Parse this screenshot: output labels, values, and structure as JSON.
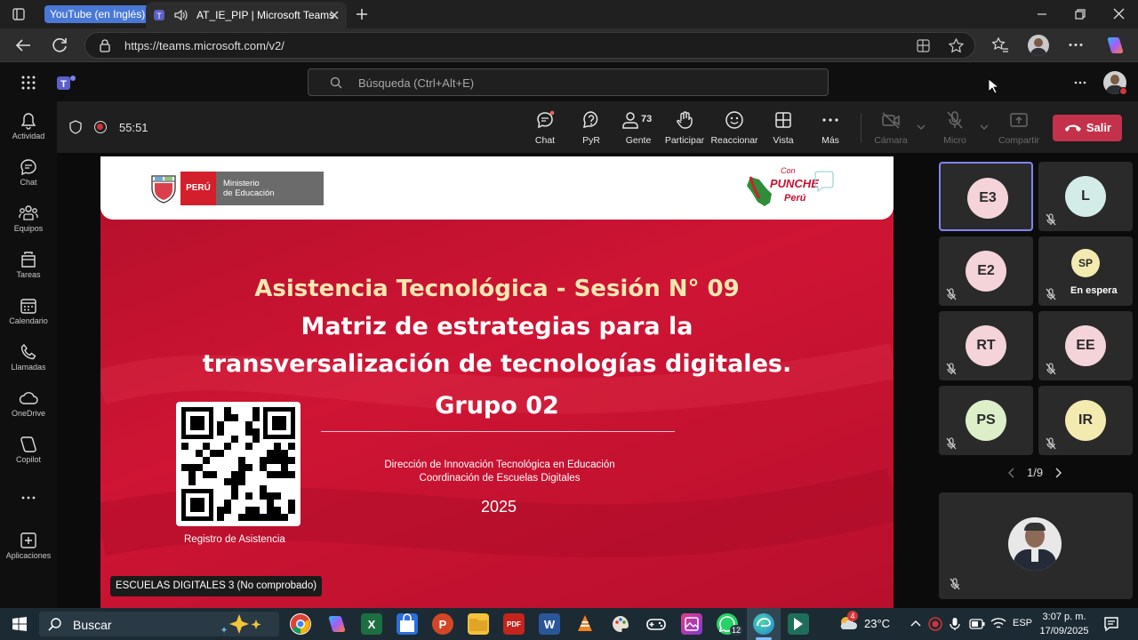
{
  "browser": {
    "tab_group": "YouTube (en Inglés)",
    "tab_title": "AT_IE_PIP | Microsoft Teams",
    "url": "https://teams.microsoft.com/v2/"
  },
  "teams": {
    "search_placeholder": "Búsqueda (Ctrl+Alt+E)",
    "rail": [
      {
        "label": "Actividad",
        "icon": "bell-icon"
      },
      {
        "label": "Chat",
        "icon": "chat-icon"
      },
      {
        "label": "Equipos",
        "icon": "teams-icon"
      },
      {
        "label": "Tareas",
        "icon": "tasks-icon"
      },
      {
        "label": "Calendario",
        "icon": "calendar-icon"
      },
      {
        "label": "Llamadas",
        "icon": "phone-icon"
      },
      {
        "label": "OneDrive",
        "icon": "cloud-icon"
      },
      {
        "label": "Copilot",
        "icon": "copilot-icon"
      },
      {
        "label": "Aplicaciones",
        "icon": "apps-plus-icon"
      }
    ]
  },
  "call": {
    "timer": "55:51",
    "toolbar": [
      {
        "label": "Chat",
        "icon": "chat-icon",
        "enabled": true
      },
      {
        "label": "PyR",
        "icon": "qna-icon",
        "enabled": true
      },
      {
        "label": "Gente",
        "icon": "people-icon",
        "badge": "73",
        "enabled": true
      },
      {
        "label": "Participar",
        "icon": "raise-hand-icon",
        "enabled": true
      },
      {
        "label": "Reaccionar",
        "icon": "smiley-icon",
        "enabled": true
      },
      {
        "label": "Vista",
        "icon": "grid-icon",
        "enabled": true
      },
      {
        "label": "Más",
        "icon": "more-icon",
        "enabled": true
      },
      {
        "label": "Cámara",
        "icon": "camera-off-icon",
        "enabled": false
      },
      {
        "label": "Micro",
        "icon": "mic-off-icon",
        "enabled": false
      },
      {
        "label": "Compartir",
        "icon": "share-icon",
        "enabled": false
      }
    ],
    "leave_label": "Salir",
    "presenter_name": "ESCUELAS DIGITALES 3 (No comprobado)"
  },
  "slide": {
    "peru": "PERÚ",
    "ministry_line1": "Ministerio",
    "ministry_line2": "de Educación",
    "brand_line1": "Con",
    "brand_line2": "PUNCHE",
    "brand_line3": "Perú",
    "title_line1": "Asistencia Tecnológica - Sesión N° 09",
    "title_line2": "Matriz de estrategias para la",
    "title_line3": "transversalización de tecnologías digitales.",
    "title_line4": "Grupo 02",
    "org_line1": "Dirección de Innovación Tecnológica en Educación",
    "org_line2": "Coordinación de Escuelas Digitales",
    "year": "2025",
    "qr_caption": "Registro de Asistencia"
  },
  "participants": [
    {
      "initials": "E3",
      "color": "#f4d3d9",
      "active": true
    },
    {
      "initials": "L",
      "color": "#d3ece7"
    },
    {
      "initials": "E2",
      "color": "#f4d3d9"
    },
    {
      "initials": "SP",
      "color": "#f3eab0",
      "status": "En espera"
    },
    {
      "initials": "RT",
      "color": "#f4d3d9"
    },
    {
      "initials": "EE",
      "color": "#f4d3d9"
    },
    {
      "initials": "PS",
      "color": "#dcefc9"
    },
    {
      "initials": "IR",
      "color": "#f3eab0"
    }
  ],
  "pagination": "1/9",
  "taskbar": {
    "search_label": "Buscar",
    "temperature": "23°C",
    "language": "ESP",
    "time": "3:07 p. m.",
    "date": "17/09/2025",
    "weather_badge": "4",
    "whatsapp_badge": "12"
  }
}
